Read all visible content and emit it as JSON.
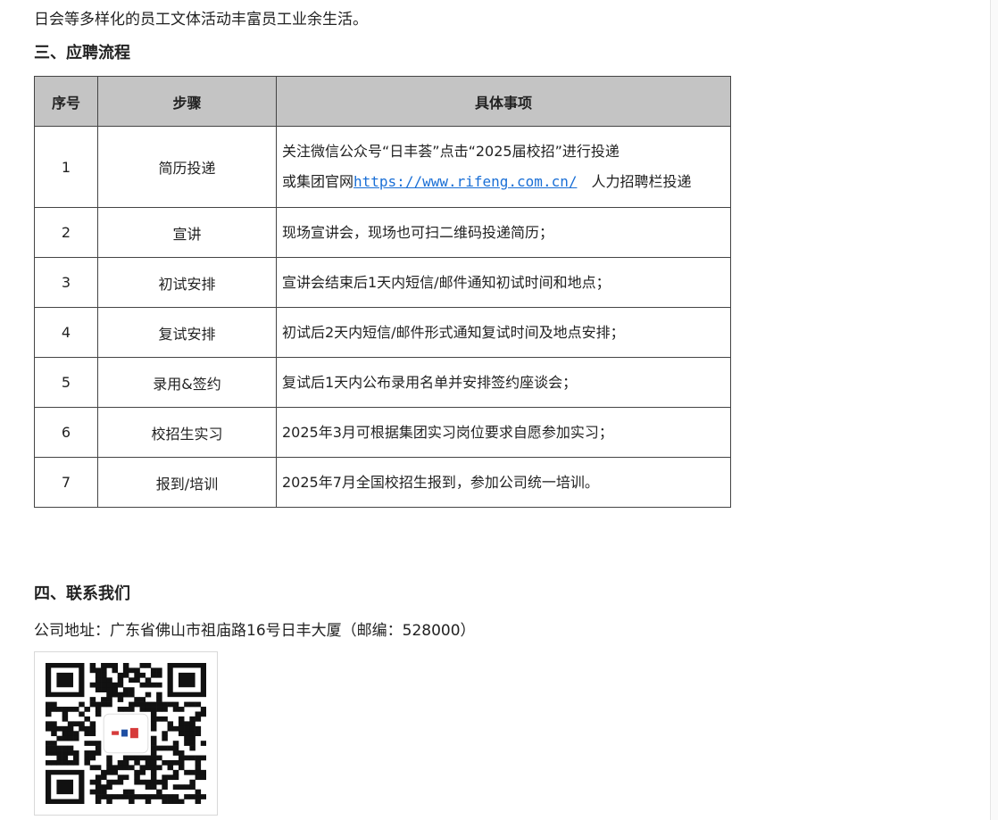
{
  "intro": {
    "line": "日会等多样化的员工文体活动丰富员工业余生活。"
  },
  "section3": {
    "heading": "三、应聘流程"
  },
  "table": {
    "headers": [
      "序号",
      "步骤",
      "具体事项"
    ],
    "rows": [
      {
        "no": "1",
        "step": "简历投递",
        "line1": "关注微信公众号“日丰荟”点击“2025届校招”进行投递",
        "line2_prefix": "或集团官网",
        "link": "https://www.rifeng.com.cn/",
        "line2_suffix": "人力招聘栏投递"
      },
      {
        "no": "2",
        "step": "宣讲",
        "detail": "现场宣讲会，现场也可扫二维码投递简历；"
      },
      {
        "no": "3",
        "step": "初试安排",
        "detail": "宣讲会结束后1天内短信/邮件通知初试时间和地点；"
      },
      {
        "no": "4",
        "step": "复试安排",
        "detail": "初试后2天内短信/邮件形式通知复试时间及地点安排；"
      },
      {
        "no": "5",
        "step": "录用&签约",
        "detail": "复试后1天内公布录用名单并安排签约座谈会；"
      },
      {
        "no": "6",
        "step": "校招生实习",
        "detail": "2025年3月可根据集团实习岗位要求自愿参加实习；"
      },
      {
        "no": "7",
        "step": "报到/培训",
        "detail": "2025年7月全国校招生报到，参加公司统一培训。"
      }
    ]
  },
  "section4": {
    "heading": "四、联系我们",
    "address": "公司地址：广东省佛山市祖庙路16号日丰大厦（邮编：528000）"
  },
  "qr": {
    "icon": "qr-code-icon",
    "logo_icon": "rifeng-logo-icon"
  }
}
